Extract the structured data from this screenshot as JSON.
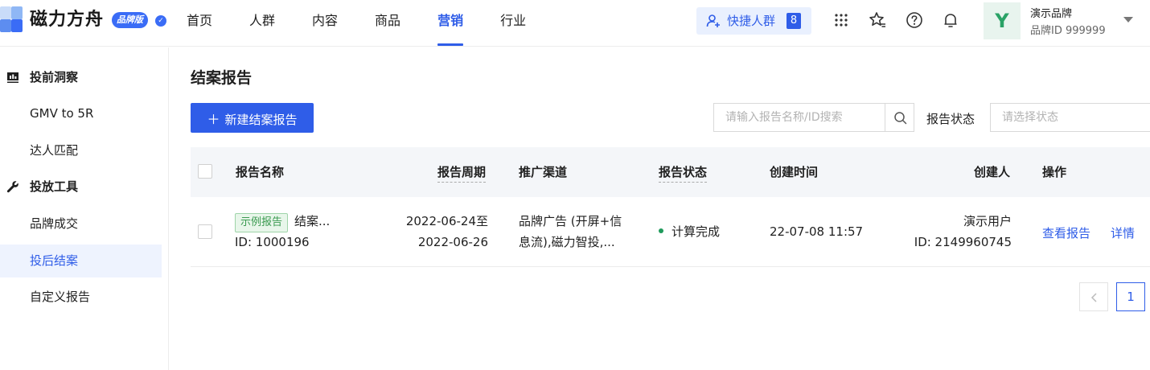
{
  "brand": {
    "name": "磁力方舟",
    "edition": "品牌版",
    "colors": {
      "accent": "#2f5de8",
      "logo": [
        "#8fb7f5",
        "#5d8df0",
        "#c9dcf9",
        "#3a6cf6"
      ]
    }
  },
  "nav": {
    "items": [
      {
        "label": "首页"
      },
      {
        "label": "人群"
      },
      {
        "label": "内容"
      },
      {
        "label": "商品"
      },
      {
        "label": "营销",
        "active": true
      },
      {
        "label": "行业"
      }
    ],
    "quick_crowd": {
      "label": "快捷人群",
      "count": "8",
      "icon": "user-add-icon"
    },
    "tools": [
      "apps-grid-icon",
      "star-list-icon",
      "help-icon",
      "bell-icon"
    ]
  },
  "user": {
    "avatar_letter": "Y",
    "name": "演示品牌",
    "id_text": "品牌ID 999999"
  },
  "sidebar": {
    "groups": [
      {
        "label": "投前洞察",
        "icon": "chart-board-icon",
        "items": [
          {
            "label": "GMV to 5R"
          },
          {
            "label": "达人匹配"
          }
        ]
      },
      {
        "label": "投放工具",
        "icon": "wrench-icon",
        "items": [
          {
            "label": "品牌成交"
          },
          {
            "label": "投后结案",
            "active": true
          },
          {
            "label": "自定义报告"
          }
        ]
      }
    ]
  },
  "main": {
    "title": "结案报告",
    "new_button": "新建结案报告",
    "search": {
      "placeholder": "请输入报告名称/ID搜索",
      "icon": "search-icon"
    },
    "status_filter": {
      "label": "报告状态",
      "placeholder": "请选择状态"
    },
    "table": {
      "columns": [
        "报告名称",
        "报告周期",
        "推广渠道",
        "报告状态",
        "创建时间",
        "创建人",
        "操作"
      ],
      "rows": [
        {
          "tag": "示例报告",
          "name": "结案...",
          "id": "ID: 1000196",
          "period_line1": "2022-06-24至",
          "period_line2": "2022-06-26",
          "channel_line1": "品牌广告 (开屏+信",
          "channel_line2": "息流),磁力智投,...",
          "status": "计算完成",
          "status_color": "#1f9a5b",
          "created": "22-07-08 11:57",
          "creator": "演示用户",
          "creator_id": "ID: 2149960745",
          "actions": [
            "查看报告",
            "详情"
          ]
        }
      ]
    },
    "pagination": {
      "current": "1"
    }
  }
}
